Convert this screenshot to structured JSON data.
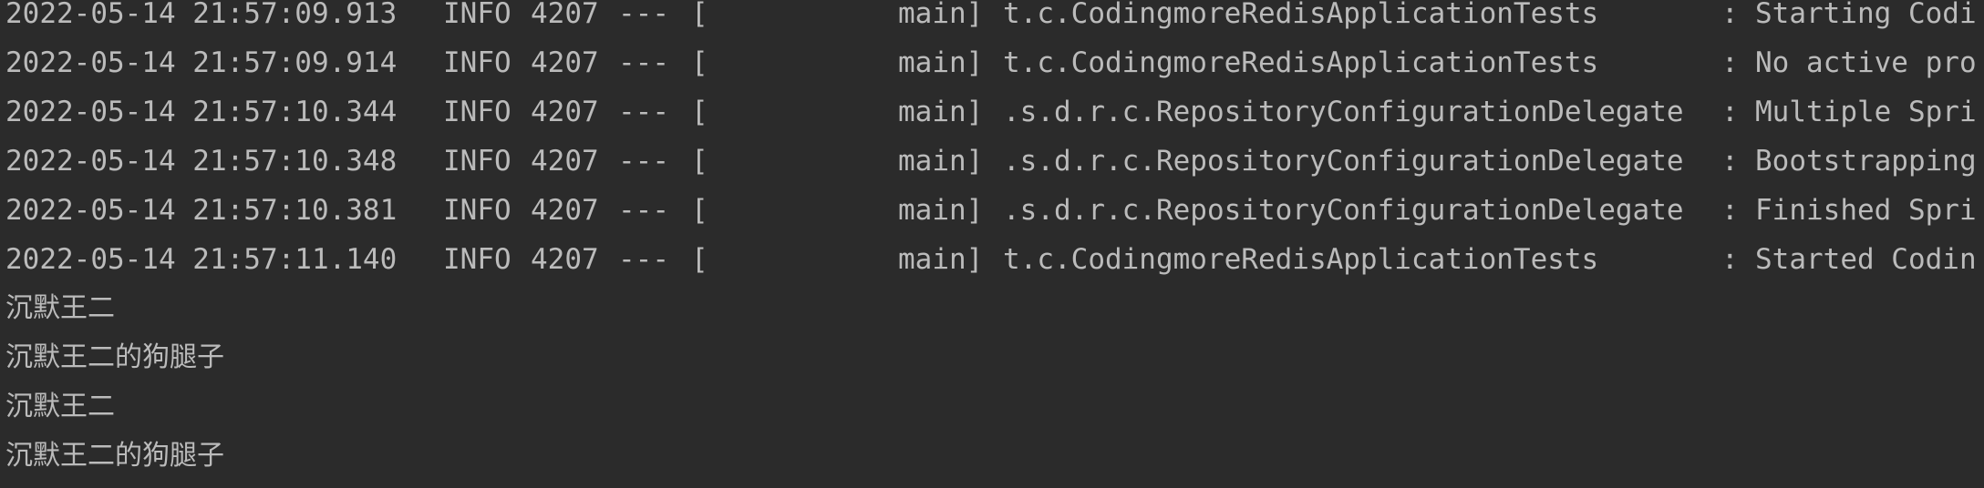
{
  "console": {
    "log_lines": [
      {
        "timestamp": "2022-05-14 21:57:09.913",
        "level": "INFO",
        "pid": "4207",
        "separator": "---",
        "bracket": "[",
        "thread": "main]",
        "logger": "t.c.CodingmoreRedisApplicationTests",
        "colon": ":",
        "message": "Starting Codi"
      },
      {
        "timestamp": "2022-05-14 21:57:09.914",
        "level": "INFO",
        "pid": "4207",
        "separator": "---",
        "bracket": "[",
        "thread": "main]",
        "logger": "t.c.CodingmoreRedisApplicationTests",
        "colon": ":",
        "message": "No active pro"
      },
      {
        "timestamp": "2022-05-14 21:57:10.344",
        "level": "INFO",
        "pid": "4207",
        "separator": "---",
        "bracket": "[",
        "thread": "main]",
        "logger": ".s.d.r.c.RepositoryConfigurationDelegate",
        "colon": ":",
        "message": "Multiple Spri"
      },
      {
        "timestamp": "2022-05-14 21:57:10.348",
        "level": "INFO",
        "pid": "4207",
        "separator": "---",
        "bracket": "[",
        "thread": "main]",
        "logger": ".s.d.r.c.RepositoryConfigurationDelegate",
        "colon": ":",
        "message": "Bootstrapping"
      },
      {
        "timestamp": "2022-05-14 21:57:10.381",
        "level": "INFO",
        "pid": "4207",
        "separator": "---",
        "bracket": "[",
        "thread": "main]",
        "logger": ".s.d.r.c.RepositoryConfigurationDelegate",
        "colon": ":",
        "message": "Finished Spri"
      },
      {
        "timestamp": "2022-05-14 21:57:11.140",
        "level": "INFO",
        "pid": "4207",
        "separator": "---",
        "bracket": "[",
        "thread": "main]",
        "logger": "t.c.CodingmoreRedisApplicationTests",
        "colon": ":",
        "message": "Started Codin"
      }
    ],
    "output_lines": [
      "沉默王二",
      "沉默王二的狗腿子",
      "沉默王二",
      "沉默王二的狗腿子"
    ]
  },
  "colors": {
    "background": "#2b2b2b",
    "text": "#bbbbbb"
  }
}
